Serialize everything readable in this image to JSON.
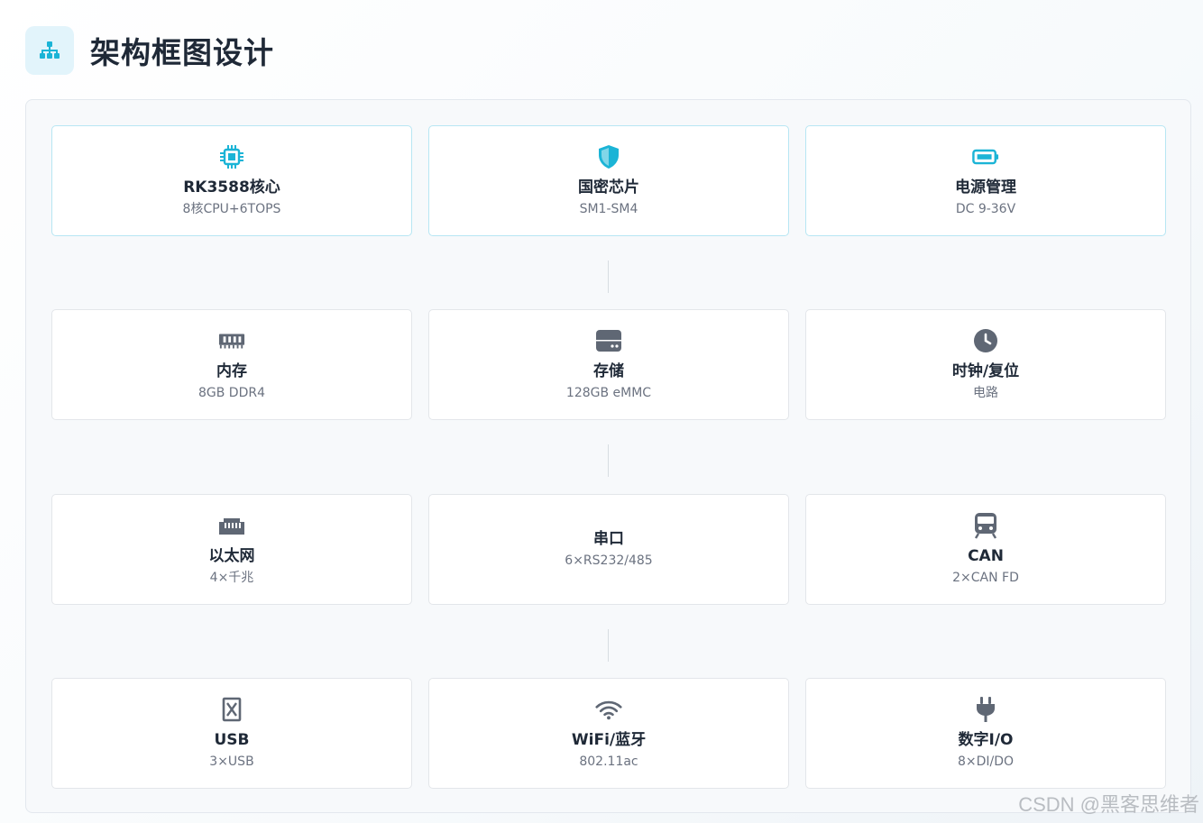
{
  "page": {
    "title": "架构框图设计",
    "header_icon": "sitemap-icon",
    "accent_color": "#1bb4d6",
    "icon_gray": "#5f6774"
  },
  "rows": [
    [
      {
        "name": "RK3588核心",
        "spec": "8核CPU+6TOPS",
        "icon": "cpu-chip-icon",
        "highlight": true
      },
      {
        "name": "国密芯片",
        "spec": "SM1-SM4",
        "icon": "shield-icon",
        "highlight": true
      },
      {
        "name": "电源管理",
        "spec": "DC 9-36V",
        "icon": "battery-icon",
        "highlight": true
      }
    ],
    [
      {
        "name": "内存",
        "spec": "8GB DDR4",
        "icon": "memory-icon",
        "highlight": false
      },
      {
        "name": "存储",
        "spec": "128GB eMMC",
        "icon": "storage-drive-icon",
        "highlight": false
      },
      {
        "name": "时钟/复位",
        "spec": "电路",
        "icon": "clock-icon",
        "highlight": false
      }
    ],
    [
      {
        "name": "以太网",
        "spec": "4×千兆",
        "icon": "ethernet-port-icon",
        "highlight": false
      },
      {
        "name": "串口",
        "spec": "6×RS232/485",
        "icon": "",
        "highlight": false
      },
      {
        "name": "CAN",
        "spec": "2×CAN FD",
        "icon": "bus-icon",
        "highlight": false
      }
    ],
    [
      {
        "name": "USB",
        "spec": "3×USB",
        "icon": "usb-icon",
        "highlight": false
      },
      {
        "name": "WiFi/蓝牙",
        "spec": "802.11ac",
        "icon": "wifi-icon",
        "highlight": false
      },
      {
        "name": "数字I/O",
        "spec": "8×DI/DO",
        "icon": "plug-icon",
        "highlight": false
      }
    ]
  ],
  "watermark": "CSDN @黑客思维者"
}
